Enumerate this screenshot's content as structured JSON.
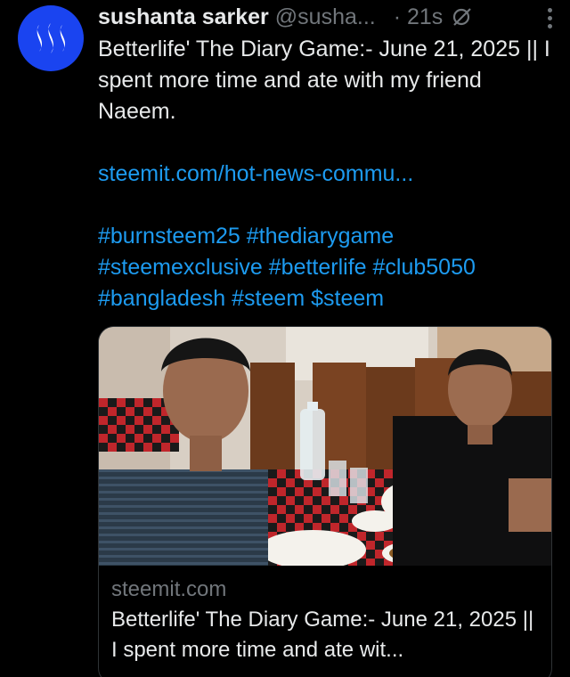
{
  "author": {
    "display_name": "sushanta sarker",
    "handle": "@susha...",
    "time": "· 21s"
  },
  "post": {
    "text": "Betterlife' The Diary Game:- June 21, 2025 || I spent more time and ate with my friend Naeem.",
    "link": "steemit.com/hot-news-commu...",
    "hashtags": [
      "#burnsteem25",
      "#thediarygame",
      "#steemexclusive",
      "#betterlife",
      "#club5050",
      "#bangladesh",
      "#steem",
      "$steem"
    ]
  },
  "card": {
    "domain": "steemit.com",
    "title": "Betterlife' The Diary Game:- June 21, 2025 || I spent more time and ate wit..."
  },
  "icons": {
    "avatar": "steem-logo-icon",
    "grok": "grok-icon",
    "more": "more-options-icon"
  },
  "colors": {
    "background": "#000000",
    "text": "#e7e9ea",
    "secondary": "#71767b",
    "link": "#1d9bf0",
    "avatar": "#1a44f0"
  }
}
